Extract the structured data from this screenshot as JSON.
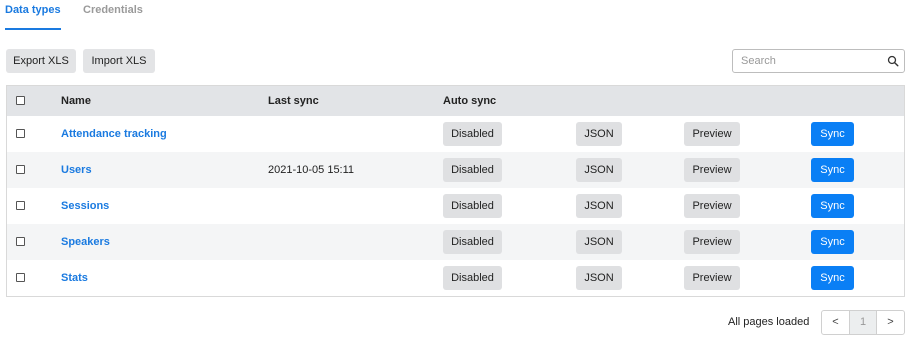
{
  "tabs": [
    {
      "label": "Data types",
      "active": true
    },
    {
      "label": "Credentials",
      "active": false
    }
  ],
  "toolbar": {
    "export_label": "Export XLS",
    "import_label": "Import XLS",
    "search_placeholder": "Search"
  },
  "table": {
    "headers": {
      "name": "Name",
      "last_sync": "Last sync",
      "auto_sync": "Auto sync"
    },
    "rows": [
      {
        "name": "Attendance tracking",
        "last_sync": "",
        "auto_sync": "Disabled",
        "json": "JSON",
        "preview": "Preview",
        "sync": "Sync"
      },
      {
        "name": "Users",
        "last_sync": "2021-10-05 15:11",
        "auto_sync": "Disabled",
        "json": "JSON",
        "preview": "Preview",
        "sync": "Sync"
      },
      {
        "name": "Sessions",
        "last_sync": "",
        "auto_sync": "Disabled",
        "json": "JSON",
        "preview": "Preview",
        "sync": "Sync"
      },
      {
        "name": "Speakers",
        "last_sync": "",
        "auto_sync": "Disabled",
        "json": "JSON",
        "preview": "Preview",
        "sync": "Sync"
      },
      {
        "name": "Stats",
        "last_sync": "",
        "auto_sync": "Disabled",
        "json": "JSON",
        "preview": "Preview",
        "sync": "Sync"
      }
    ]
  },
  "pagination": {
    "status": "All pages loaded",
    "prev": "<",
    "page": "1",
    "next": ">"
  },
  "colors": {
    "accent": "#1a7ae0",
    "sync_button": "#0a7ff5",
    "header_bg": "#e2e4e7"
  }
}
